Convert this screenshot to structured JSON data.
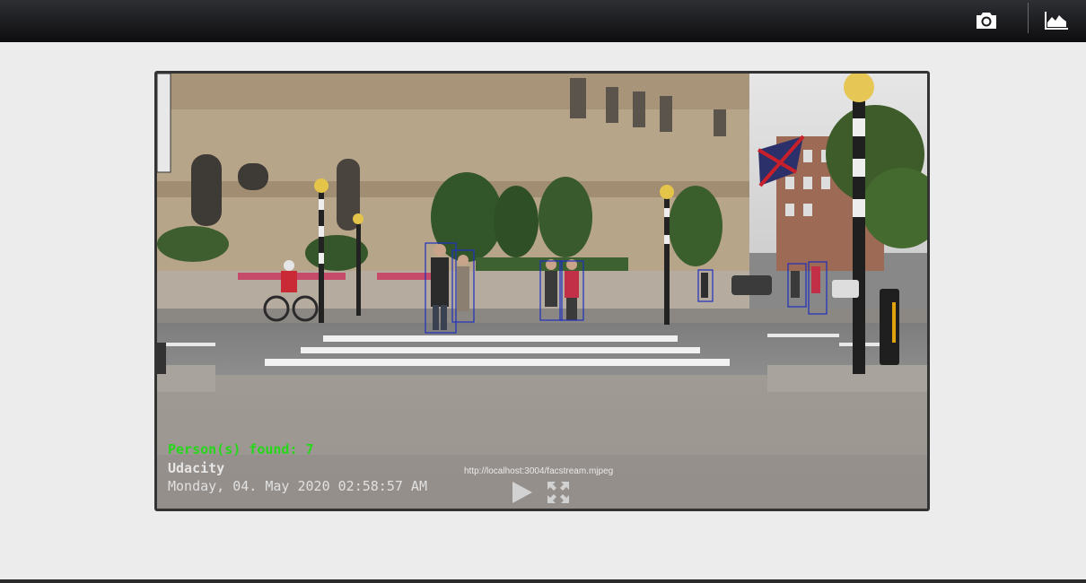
{
  "toolbar": {
    "camera_icon": "camera-icon",
    "chart_icon": "area-chart-icon"
  },
  "video": {
    "persons_found": "Person(s) found: 7",
    "brand": "Udacity",
    "datetime": "Monday, 04. May 2020 02:58:57 AM",
    "stream_url": "http://localhost:3004/facstream.mjpeg",
    "play_icon": "play-icon",
    "fullscreen_icon": "fullscreen-icon"
  },
  "colors": {
    "topbar": "#1c1d20",
    "background": "#ececec",
    "found_text": "#27d61b",
    "detection_box": "#1f2fbf"
  }
}
